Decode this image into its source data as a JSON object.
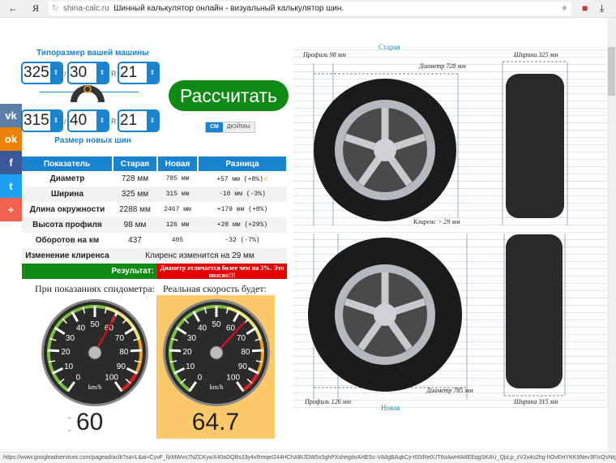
{
  "browser": {
    "back_icon": "arrow-left-icon",
    "yandex_logo": "Я",
    "domain": "shina-calc.ru",
    "title": "Шинный калькулятор онлайн - визуальный калькулятор шин."
  },
  "social": [
    {
      "name": "vk",
      "label": "vk",
      "color": "#5b7fa6"
    },
    {
      "name": "ok",
      "label": "ok",
      "color": "#ee8208"
    },
    {
      "name": "facebook",
      "label": "f",
      "color": "#3b5998"
    },
    {
      "name": "twitter",
      "label": "t",
      "color": "#1da1f2"
    },
    {
      "name": "more",
      "label": "+",
      "color": "#f0604f"
    }
  ],
  "form": {
    "old_label": "Типоразмер вашей машины",
    "new_label": "Размер новых шин",
    "old": {
      "width": "325",
      "profile": "30",
      "radius": "21"
    },
    "new": {
      "width": "315",
      "profile": "40",
      "radius": "21"
    },
    "slash": "/",
    "r": "R",
    "calc_button": "Рассчитать",
    "units": [
      "СМ",
      "ДЮЙМЫ"
    ]
  },
  "table": {
    "headers": [
      "Показатель",
      "Старая",
      "Новая",
      "Разница"
    ],
    "rows": [
      [
        "Диаметр",
        "728 мм",
        "785 мм",
        "+57 мм (+8%)"
      ],
      [
        "Ширина",
        "325 мм",
        "315 мм",
        "-10 мм (-3%)"
      ],
      [
        "Длина окружности",
        "2288 мм",
        "2467 мм",
        "+179 мм (+8%)"
      ],
      [
        "Высота профиля",
        "98 мм",
        "126 мм",
        "+28 мм (+29%)"
      ],
      [
        "Оборотов на км",
        "437",
        "405",
        "-32 (-7%)"
      ]
    ],
    "clearance_label": "Изменение клиренса",
    "clearance_value": "Клиренс изменится на 29 мм",
    "result_label": "Результат:",
    "result_value": "Диаметр отличается более чем на 3%. Это опасно!!!"
  },
  "speed": {
    "left_caption": "При показаниях спидометра:",
    "right_caption": "Реальная скорость будет:",
    "input_value": "60",
    "real_value": "64.7",
    "input_speed": 60,
    "real_speed": 64.7,
    "unit": "km/h",
    "ticks": [
      "0",
      "10",
      "20",
      "30",
      "40",
      "50",
      "60",
      "70",
      "80",
      "90",
      "100"
    ]
  },
  "visual": {
    "old_title": "Старая",
    "new_title": "Новая",
    "old_profile": "Профиль 98 мм",
    "old_width": "Ширина 325 мм",
    "old_diameter": "Диаметр 728 мм",
    "clearance": "Клиренс > 29 мм",
    "new_diameter": "Диаметр 785 мм",
    "new_profile": "Профиль 126 мм",
    "new_width": "Ширина 315 мм"
  },
  "status_url": "https://www.googleadservices.com/pagead/aclk?sa=L&ai=CyvF_llzMWvn7NZCKywX40aDQBs33y4xRmqeI244HChABIJDW5x5ghPXshegdoAHESc-VA8gBAqkCy-t00IRe0UT6oAwHIA8EEqgSKAU_QpLp_zV2x4o2hg-hOvEHYKK9Nev3FIxQsNtgk6LKJtaQFJ48bkfsYS..."
}
